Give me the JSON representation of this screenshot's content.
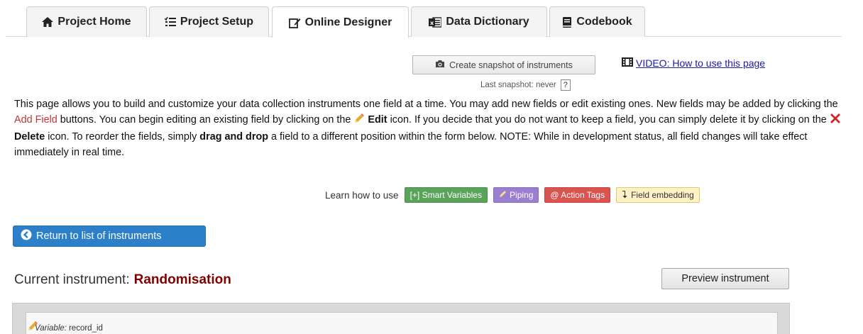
{
  "tabs": [
    {
      "label": "Project Home",
      "icon": "home-icon"
    },
    {
      "label": "Project Setup",
      "icon": "list-check-icon"
    },
    {
      "label": "Online Designer",
      "icon": "edit-icon",
      "active": true
    },
    {
      "label": "Data Dictionary",
      "icon": "excel-icon"
    },
    {
      "label": "Codebook",
      "icon": "book-icon"
    }
  ],
  "snapshot": {
    "button_label": "Create snapshot of instruments",
    "last_snapshot": "Last snapshot: never",
    "help": "?"
  },
  "video_link": "VIDEO: How to use this page",
  "description": {
    "p1": "This page allows you to build and customize your data collection instruments one field at a time. You may add new fields or edit existing ones. New fields may be added by clicking the ",
    "add_field": "Add Field",
    "p2": " buttons. You can begin editing an existing field by clicking on the ",
    "edit": "Edit",
    "p3": " icon. If you decide that you do not want to keep a field, you can simply delete it by clicking on the ",
    "delete": "Delete",
    "p4": " icon. To reorder the fields, simply ",
    "drag": "drag and drop",
    "p5": " a field to a different position within the form below. NOTE: While in development status, all field changes will take effect immediately in real time."
  },
  "learn": {
    "label": "Learn how to use",
    "smart": "[+] Smart Variables",
    "piping": "Piping",
    "action": "@ Action Tags",
    "embed": "Field embedding"
  },
  "return_button": "Return to list of instruments",
  "current": {
    "label": "Current instrument:",
    "name": "Randomisation"
  },
  "preview_button": "Preview instrument",
  "field": {
    "var_label": "Variable:",
    "var_name": "record_id"
  },
  "colors": {
    "accent": "#2c80c9",
    "instrument_name": "#800000",
    "add_field": "#c03535"
  }
}
